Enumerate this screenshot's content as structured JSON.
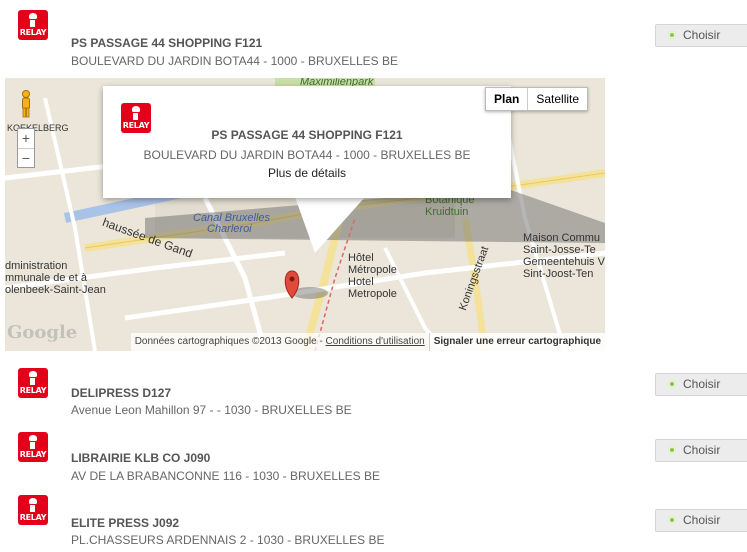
{
  "relay_logo_text": "RELAY",
  "choose_label": "Choisir",
  "stores": [
    {
      "name": "PS PASSAGE 44 SHOPPING F121",
      "address": "BOULEVARD DU JARDIN BOTA44 - 1000 - BRUXELLES BE"
    },
    {
      "name": "DELIPRESS D127",
      "address": "Avenue Leon Mahillon 97 - - 1030 - BRUXELLES BE"
    },
    {
      "name": "LIBRAIRIE KLB CO J090",
      "address": "AV DE LA BRABANCONNE 116 - 1030 - BRUXELLES BE"
    },
    {
      "name": "ELITE PRESS J092",
      "address": "PL.CHASSEURS ARDENNAIS 2 - 1030 - BRUXELLES BE"
    }
  ],
  "map": {
    "toggle_plan": "Plan",
    "toggle_satellite": "Satellite",
    "zoom_in": "+",
    "zoom_out": "−",
    "popup": {
      "name": "PS PASSAGE 44 SHOPPING F121",
      "address": "BOULEVARD DU JARDIN BOTA44 - 1000 - BRUXELLES BE",
      "more_link": "Plus de détails"
    },
    "attribution": "Données cartographiques ©2013 Google - ",
    "terms_link": "Conditions d'utilisation",
    "report_link": "Signaler une erreur cartographique",
    "google_logo": "Google",
    "labels": {
      "koekelberg": "KOEKELBERG",
      "maximilienpark": "Maximilienpark",
      "canal": "Canal Bruxelles",
      "charleroi": "Charleroi",
      "chaussee": "haussée de Gand",
      "botanique": "Botanique",
      "kruidtuin": "Kruidtuin",
      "hotel": "Hôtel",
      "metropole": "Métropole",
      "hotel2": "Hotel",
      "metropole2": "Metropole",
      "admin1": "dministration",
      "admin2": "mmunale de et à",
      "admin3": "olenbeek-Saint-Jean",
      "maison1": "Maison Commu",
      "maison2": "Saint-Josse-Te",
      "maison3": "Gemeentehuis V",
      "maison4": "Sint-Joost-Ten",
      "koningsstraat": "Koningsstraat",
      "metro": "M"
    }
  }
}
